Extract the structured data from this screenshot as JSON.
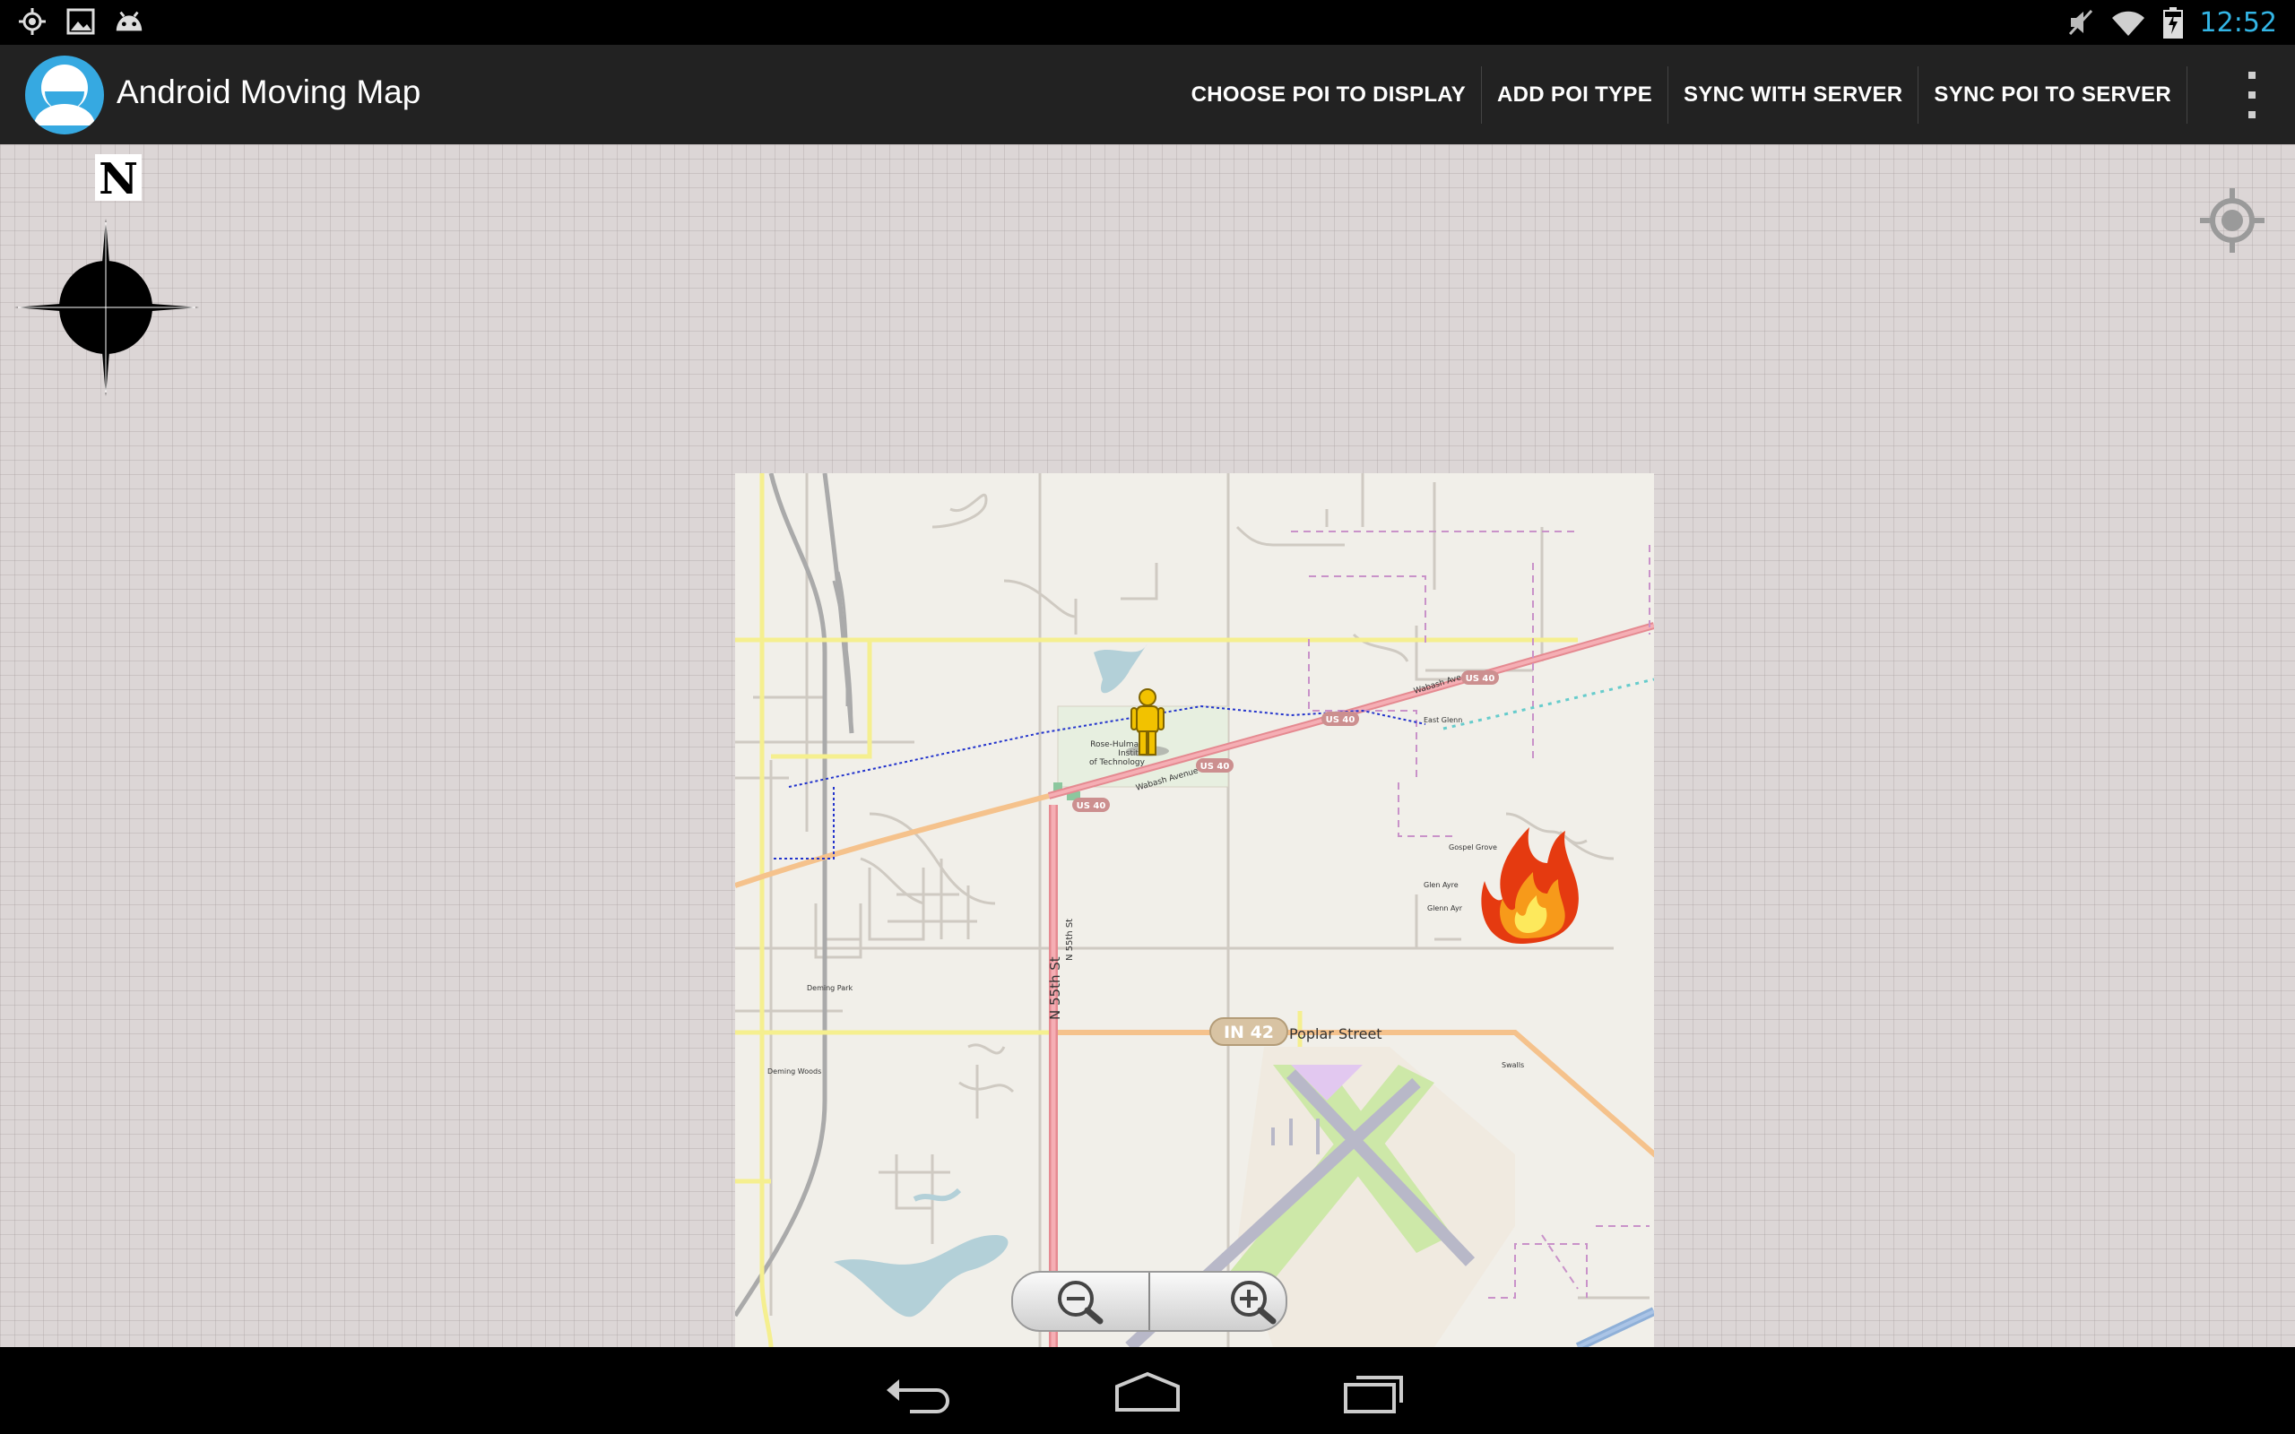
{
  "status_bar": {
    "left_icons": [
      "gps-icon",
      "picture-icon",
      "android-debug-icon"
    ],
    "right_icons": [
      "mute-icon",
      "wifi-icon",
      "battery-charging-icon"
    ],
    "time": "12:52"
  },
  "action_bar": {
    "title": "Android Moving Map",
    "actions": [
      "CHOOSE POI TO DISPLAY",
      "ADD POI TYPE",
      "SYNC WITH SERVER",
      "SYNC POI TO SERVER"
    ]
  },
  "compass": {
    "label": "N"
  },
  "map": {
    "labels": {
      "road_a": "N 55th St",
      "road_b": "N 55th St",
      "highway_us40_a": "US 40",
      "highway_us40_b": "US 40",
      "highway_us40_c": "US 40",
      "highway_us40_d": "US 40",
      "wabash_a": "Wabash Ave",
      "wabash_b": "Wabash Avenue",
      "campus": "Rose-Hulman Institute of Technology",
      "in42_shield": "IN 42",
      "poplar": "Poplar Street",
      "east_glenn": "East Glenn",
      "gospel_grove": "Gospel Grove",
      "glen_ayre": "Glen Ayre",
      "glenn_ayr": "Glenn Ayr",
      "deming_park": "Deming Park",
      "deming_woods": "Deming Woods",
      "swalls": "Swalls"
    },
    "markers": [
      "person-marker",
      "fire-poi-marker"
    ]
  },
  "colors": {
    "accent": "#33b5e5",
    "action_bar": "#222222",
    "highway": "#e58a91",
    "secondary_road": "#f9c998",
    "tertiary_road": "#fbf7a9"
  }
}
